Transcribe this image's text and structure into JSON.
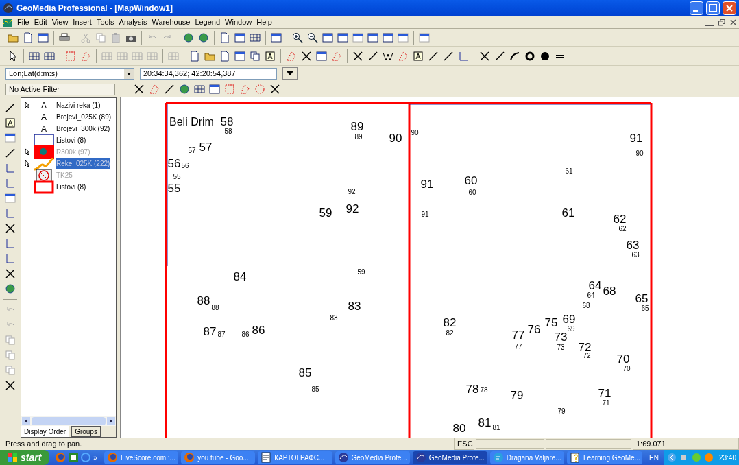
{
  "window": {
    "title": "GeoMedia Professional - [MapWindow1]"
  },
  "menu": [
    "File",
    "Edit",
    "View",
    "Insert",
    "Tools",
    "Analysis",
    "Warehouse",
    "Legend",
    "Window",
    "Help"
  ],
  "coordinates": {
    "system": "Lon;Lat(d:m:s)",
    "value": "20:34:34,362; 42:20:54,387"
  },
  "filter": {
    "value": "No Active Filter"
  },
  "legend": {
    "items": [
      {
        "label": "Nazivi reka (1)",
        "kind": "text",
        "symbol_text": "A",
        "locatable": true,
        "displayed": true,
        "selected": false
      },
      {
        "label": "Brojevi_025K (89)",
        "kind": "text",
        "symbol_text": "A",
        "locatable": false,
        "displayed": true,
        "selected": false
      },
      {
        "label": "Brojevi_300k (92)",
        "kind": "text",
        "symbol_text": "A",
        "locatable": false,
        "displayed": true,
        "selected": false
      },
      {
        "label": "Listovi (8)",
        "kind": "blue-outline",
        "locatable": false,
        "displayed": true,
        "selected": false
      },
      {
        "label": "R300k (97)",
        "kind": "raster",
        "locatable": true,
        "displayed": false,
        "selected": false
      },
      {
        "label": "Reke_025K (222)",
        "kind": "line",
        "locatable": true,
        "displayed": false,
        "selected": true
      },
      {
        "label": "TK25",
        "kind": "no-raster",
        "locatable": false,
        "displayed": false,
        "selected": false
      },
      {
        "label": "Listovi (8)",
        "kind": "red-outline",
        "locatable": false,
        "displayed": true,
        "selected": false
      }
    ],
    "tabs": [
      {
        "label": "Display Order",
        "selected": true
      },
      {
        "label": "Groups",
        "selected": false
      }
    ]
  },
  "map": {
    "river_label": "Beli Drim",
    "labels": [
      {
        "text": "58",
        "kind": "large"
      },
      {
        "text": "58",
        "kind": "small"
      },
      {
        "text": "89",
        "kind": "large"
      },
      {
        "text": "89",
        "kind": "small"
      },
      {
        "text": "90",
        "kind": "large"
      },
      {
        "text": "90",
        "kind": "small"
      },
      {
        "text": "91",
        "kind": "large"
      },
      {
        "text": "57",
        "kind": "small"
      },
      {
        "text": "57",
        "kind": "large"
      },
      {
        "text": "90",
        "kind": "small"
      },
      {
        "text": "56",
        "kind": "large"
      },
      {
        "text": "56",
        "kind": "small"
      },
      {
        "text": "61",
        "kind": "small"
      },
      {
        "text": "55",
        "kind": "small"
      },
      {
        "text": "60",
        "kind": "large"
      },
      {
        "text": "91",
        "kind": "large"
      },
      {
        "text": "55",
        "kind": "large"
      },
      {
        "text": "92",
        "kind": "small"
      },
      {
        "text": "60",
        "kind": "small"
      },
      {
        "text": "92",
        "kind": "large"
      },
      {
        "text": "59",
        "kind": "large"
      },
      {
        "text": "91",
        "kind": "small"
      },
      {
        "text": "61",
        "kind": "large"
      },
      {
        "text": "62",
        "kind": "large"
      },
      {
        "text": "62",
        "kind": "small"
      },
      {
        "text": "63",
        "kind": "large"
      },
      {
        "text": "63",
        "kind": "small"
      },
      {
        "text": "84",
        "kind": "large"
      },
      {
        "text": "59",
        "kind": "small"
      },
      {
        "text": "88",
        "kind": "large"
      },
      {
        "text": "88",
        "kind": "small"
      },
      {
        "text": "83",
        "kind": "large"
      },
      {
        "text": "68",
        "kind": "small"
      },
      {
        "text": "64",
        "kind": "small"
      },
      {
        "text": "64",
        "kind": "large"
      },
      {
        "text": "68",
        "kind": "large"
      },
      {
        "text": "65",
        "kind": "large"
      },
      {
        "text": "65",
        "kind": "small"
      },
      {
        "text": "87",
        "kind": "large"
      },
      {
        "text": "87",
        "kind": "small"
      },
      {
        "text": "86",
        "kind": "small"
      },
      {
        "text": "86",
        "kind": "large"
      },
      {
        "text": "83",
        "kind": "small"
      },
      {
        "text": "82",
        "kind": "large"
      },
      {
        "text": "82",
        "kind": "small"
      },
      {
        "text": "77",
        "kind": "large"
      },
      {
        "text": "76",
        "kind": "large"
      },
      {
        "text": "75",
        "kind": "large"
      },
      {
        "text": "73",
        "kind": "large"
      },
      {
        "text": "69",
        "kind": "large"
      },
      {
        "text": "69",
        "kind": "small"
      },
      {
        "text": "77",
        "kind": "small"
      },
      {
        "text": "73",
        "kind": "small"
      },
      {
        "text": "72",
        "kind": "large"
      },
      {
        "text": "72",
        "kind": "small"
      },
      {
        "text": "70",
        "kind": "large"
      },
      {
        "text": "85",
        "kind": "large"
      },
      {
        "text": "70",
        "kind": "small"
      },
      {
        "text": "85",
        "kind": "small"
      },
      {
        "text": "78",
        "kind": "large"
      },
      {
        "text": "78",
        "kind": "small"
      },
      {
        "text": "79",
        "kind": "large"
      },
      {
        "text": "71",
        "kind": "large"
      },
      {
        "text": "71",
        "kind": "small"
      },
      {
        "text": "79",
        "kind": "small"
      },
      {
        "text": "80",
        "kind": "large"
      },
      {
        "text": "81",
        "kind": "large"
      },
      {
        "text": "81",
        "kind": "small"
      }
    ]
  },
  "status_bar": {
    "message": "Press and drag to pan.",
    "key": "ESC",
    "scale": "1:69.071"
  },
  "taskbar": {
    "start": "start",
    "more": "»",
    "tasks": [
      {
        "label": "LiveScore.com :...",
        "kind": "browser",
        "selected": false
      },
      {
        "label": "you tube - Goo...",
        "kind": "browser",
        "selected": false
      },
      {
        "label": "КАРТОГРАФС...",
        "kind": "document",
        "selected": false
      },
      {
        "label": "GeoMedia Profe...",
        "kind": "geomedia",
        "selected": false
      },
      {
        "label": "GeoMedia Profe...",
        "kind": "geomedia",
        "selected": true
      },
      {
        "label": "Dragana Valjare...",
        "kind": "chat",
        "selected": false
      },
      {
        "label": "Learning GeoMe...",
        "kind": "help",
        "selected": false
      }
    ],
    "language": "EN",
    "clock": "23:40"
  }
}
